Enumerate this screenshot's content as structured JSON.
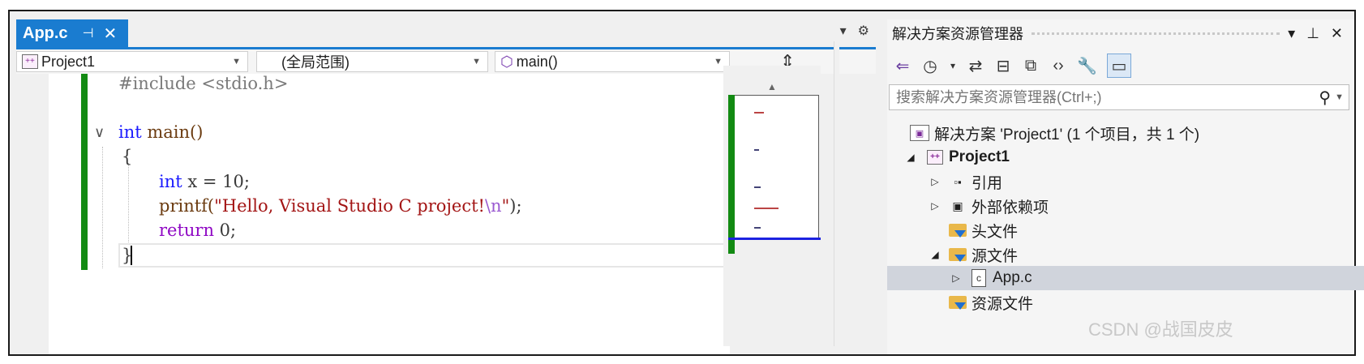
{
  "editor": {
    "tab": {
      "title": "App.c",
      "pin_glyph": "⊣",
      "close_glyph": "✕"
    },
    "tabstrip_controls": {
      "dropdown_glyph": "▾",
      "settings_glyph": "⚙"
    },
    "nav": {
      "project": "Project1",
      "scope": "(全局范围)",
      "member": "main()",
      "split_glyph": "⇕"
    },
    "code": {
      "line1": "#include <stdio.h>",
      "line3_kw": "int",
      "line3_rest": " main()",
      "line4": "{",
      "line5_kw": "int",
      "line5_rest": " x = 10;",
      "line6_fn": "printf(",
      "line6_str1": "\"Hello, Visual Studio C project!",
      "line6_esc": "\\n",
      "line6_str2": "\"",
      "line6_end": ");",
      "line7_kw": "return",
      "line7_rest": " 0;",
      "line8": "}"
    },
    "colors": {
      "accent": "#1a7cd0",
      "change_bar": "#128a12",
      "keyword": "#1a1aff",
      "string": "#a31515"
    }
  },
  "solution_explorer": {
    "title": "解决方案资源管理器",
    "title_controls": {
      "dropdown": "▾",
      "pin": "⊥",
      "close": "✕"
    },
    "toolbar": {
      "sync": "⇄",
      "history": "◷",
      "history_arrow": "▾",
      "collapse": "⊟",
      "copy": "⧉",
      "code": "‹›",
      "wrench": "🔧",
      "preview": "▭"
    },
    "search_placeholder": "搜索解决方案资源管理器(Ctrl+;)",
    "search_glyph": "⚲",
    "tree": {
      "solution": "解决方案 'Project1' (1 个项目，共 1 个)",
      "project": "Project1",
      "references": "引用",
      "external_deps": "外部依赖项",
      "headers": "头文件",
      "sources": "源文件",
      "app_c": "App.c",
      "resources": "资源文件"
    }
  },
  "watermark": "CSDN @战国皮皮"
}
